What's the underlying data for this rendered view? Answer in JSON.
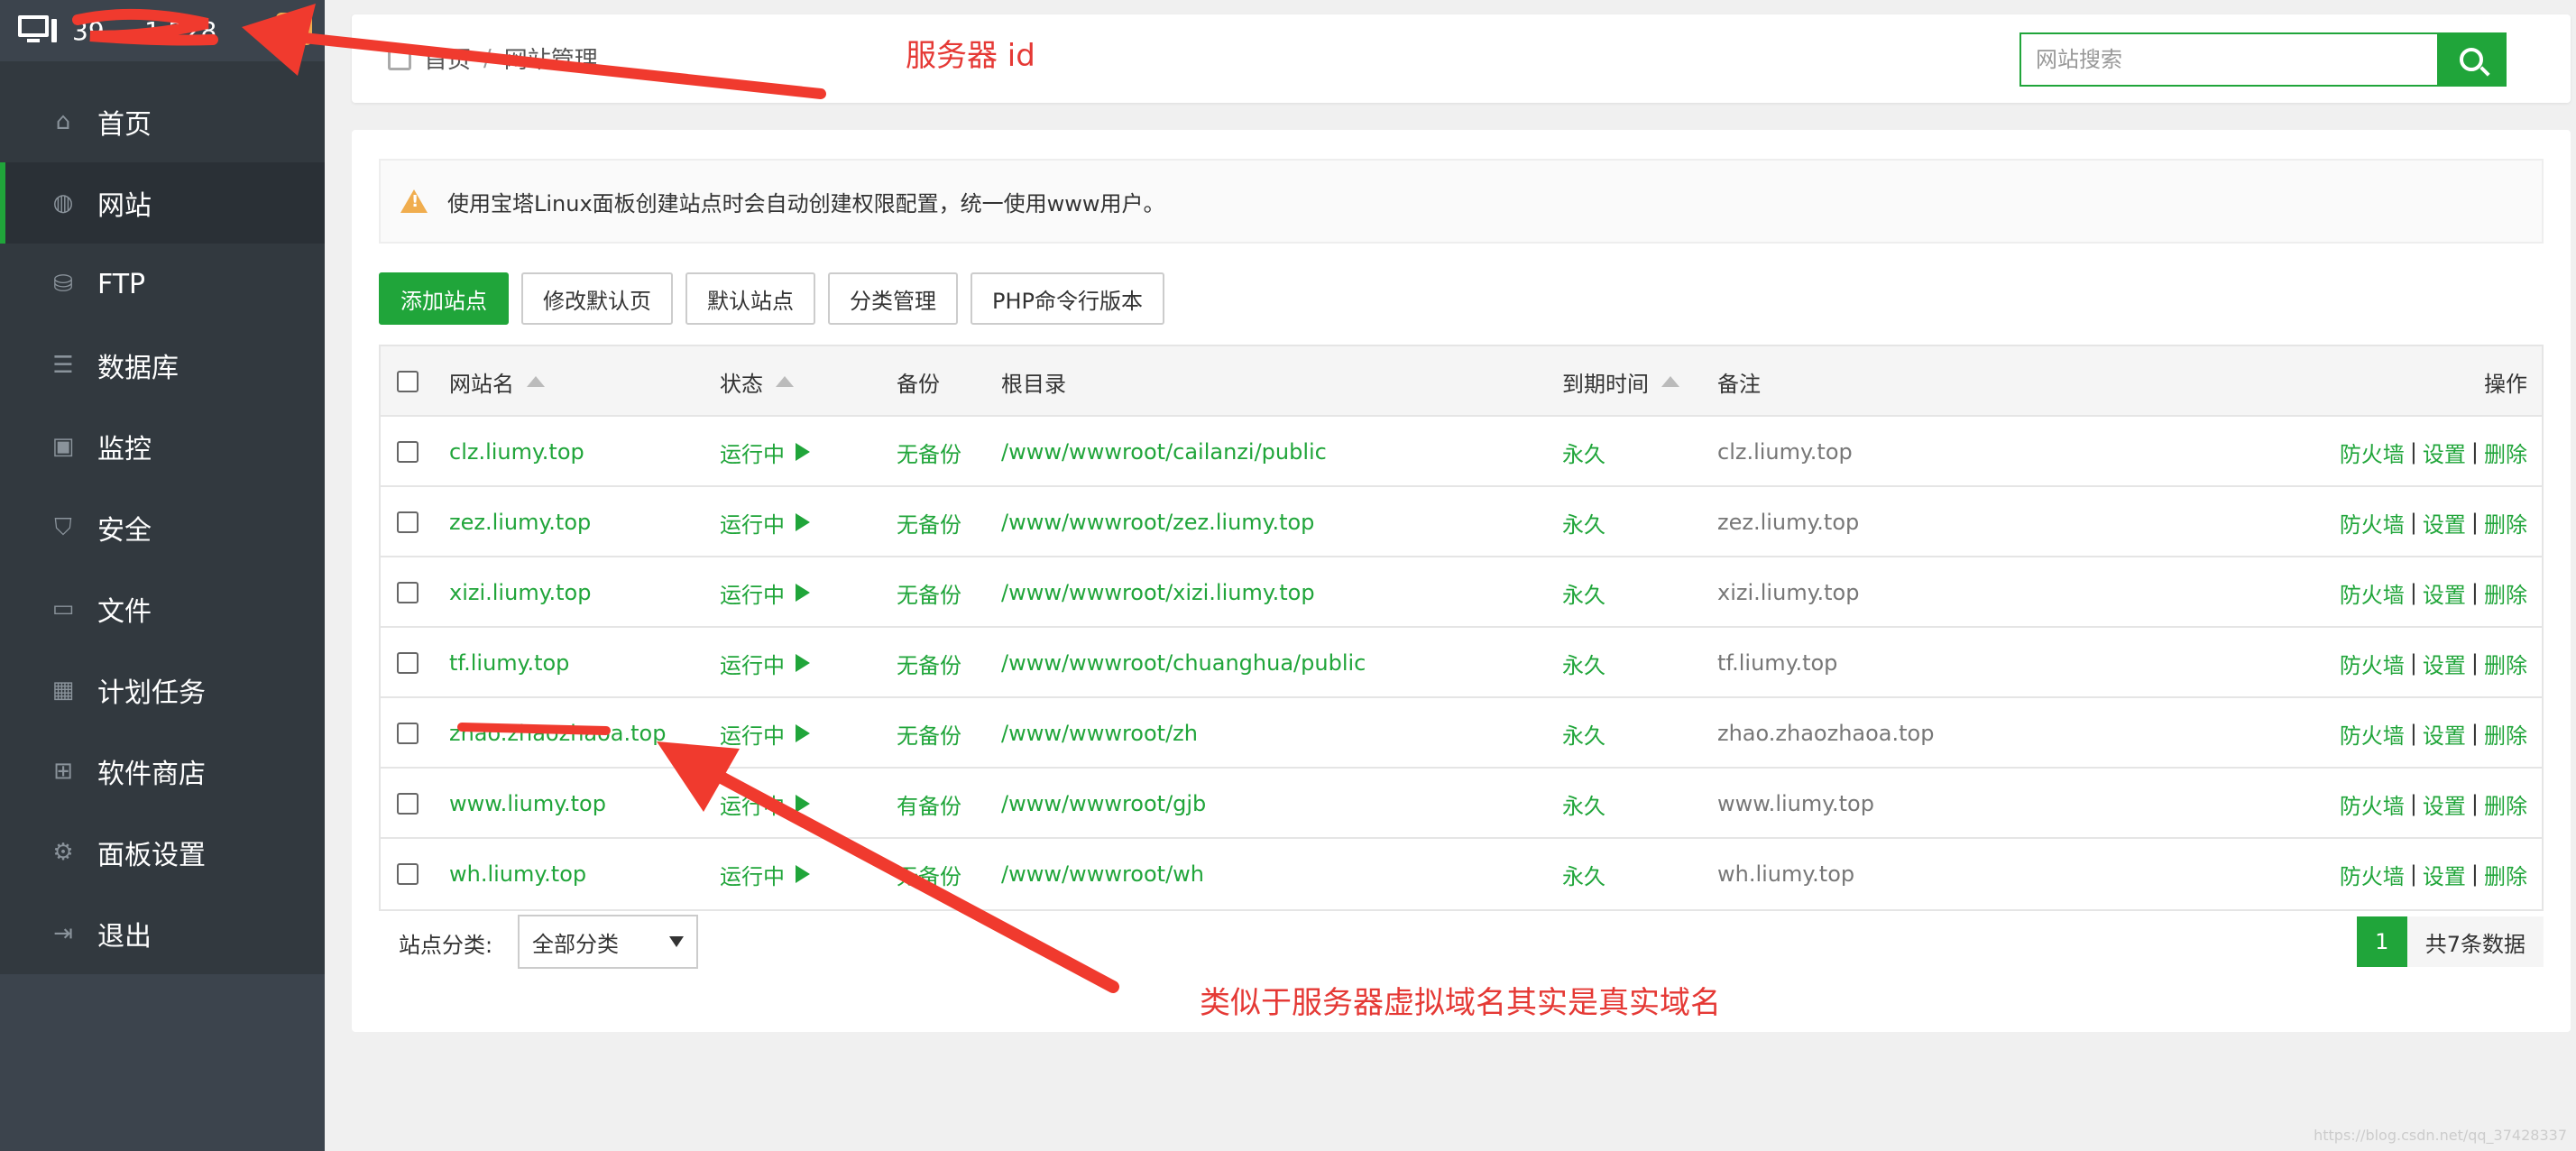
{
  "sidebar": {
    "server_id": "39  .  .  1.228",
    "badge": "0",
    "items": [
      {
        "label": "首页",
        "icon": "home-icon",
        "glyph": "⌂"
      },
      {
        "label": "网站",
        "icon": "globe-icon",
        "glyph": "◍"
      },
      {
        "label": "FTP",
        "icon": "ftp-icon",
        "glyph": "⛁"
      },
      {
        "label": "数据库",
        "icon": "database-icon",
        "glyph": "☰"
      },
      {
        "label": "监控",
        "icon": "monitor-icon",
        "glyph": "▣"
      },
      {
        "label": "安全",
        "icon": "shield-icon",
        "glyph": "⛉"
      },
      {
        "label": "文件",
        "icon": "folder-icon",
        "glyph": "▭"
      },
      {
        "label": "计划任务",
        "icon": "calendar-icon",
        "glyph": "▦"
      },
      {
        "label": "软件商店",
        "icon": "grid-icon",
        "glyph": "⊞"
      },
      {
        "label": "面板设置",
        "icon": "gear-icon",
        "glyph": "⚙"
      },
      {
        "label": "退出",
        "icon": "logout-icon",
        "glyph": "⇥"
      }
    ],
    "add": "+"
  },
  "header": {
    "crumb_home": "首页",
    "crumb_sep": "/",
    "crumb_current": "网站管理",
    "search_placeholder": "网站搜索"
  },
  "notice": "使用宝塔Linux面板创建站点时会自动创建权限配置，统一使用www用户。",
  "toolbar": {
    "add_site": "添加站点",
    "edit_default": "修改默认页",
    "default_site": "默认站点",
    "category_manage": "分类管理",
    "php_cli": "PHP命令行版本"
  },
  "table": {
    "headers": {
      "name": "网站名",
      "status": "状态",
      "backup": "备份",
      "root": "根目录",
      "expire": "到期时间",
      "note": "备注",
      "ops": "操作"
    },
    "rows": [
      {
        "name": "clz.liumy.top",
        "status": "运行中",
        "backup": "无备份",
        "root": "/www/wwwroot/cailanzi/public",
        "expire": "永久",
        "note": "clz.liumy.top"
      },
      {
        "name": "zez.liumy.top",
        "status": "运行中",
        "backup": "无备份",
        "root": "/www/wwwroot/zez.liumy.top",
        "expire": "永久",
        "note": "zez.liumy.top"
      },
      {
        "name": "xizi.liumy.top",
        "status": "运行中",
        "backup": "无备份",
        "root": "/www/wwwroot/xizi.liumy.top",
        "expire": "永久",
        "note": "xizi.liumy.top"
      },
      {
        "name": "tf.liumy.top",
        "status": "运行中",
        "backup": "无备份",
        "root": "/www/wwwroot/chuanghua/public",
        "expire": "永久",
        "note": "tf.liumy.top"
      },
      {
        "name": "zhao.zhaozhaoa.top",
        "status": "运行中",
        "backup": "无备份",
        "root": "/www/wwwroot/zh",
        "expire": "永久",
        "note": "zhao.zhaozhaoa.top"
      },
      {
        "name": "www.liumy.top",
        "status": "运行中",
        "backup": "有备份",
        "root": "/www/wwwroot/gjb",
        "expire": "永久",
        "note": "www.liumy.top"
      },
      {
        "name": "wh.liumy.top",
        "status": "运行中",
        "backup": "无备份",
        "root": "/www/wwwroot/wh",
        "expire": "永久",
        "note": "wh.liumy.top"
      }
    ],
    "ops": {
      "firewall": "防火墙",
      "settings": "设置",
      "delete": "删除",
      "sep": "|"
    }
  },
  "footer": {
    "category_label": "站点分类:",
    "category_value": "全部分类",
    "page": "1",
    "total": "共7条数据"
  },
  "annotations": {
    "server_id_note": "服务器 id",
    "domain_note": "类似于服务器虚拟域名其实是真实域名"
  },
  "watermark": "https://blog.csdn.net/qq_37428337",
  "colors": {
    "accent": "#20a53a",
    "annotation": "#e53935",
    "sidebar": "#32393f"
  }
}
